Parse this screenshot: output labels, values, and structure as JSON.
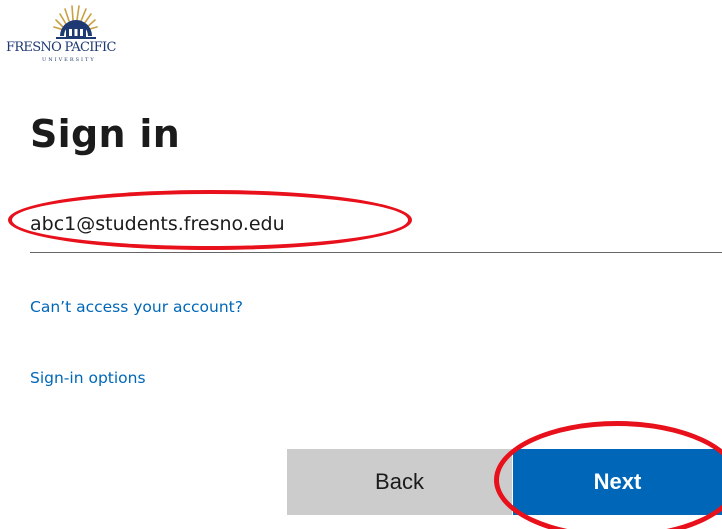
{
  "logo": {
    "wordmark": "FRESNO PACIFIC",
    "subline": "UNIVERSITY",
    "icon": "sunrise-building-crest-icon",
    "colors": {
      "navy": "#1f3a73",
      "gold": "#c9a043"
    }
  },
  "page": {
    "title": "Sign in"
  },
  "email": {
    "value": "abc1@students.fresno.edu"
  },
  "links": {
    "cant_access": "Can’t access your account?",
    "signin_options": "Sign-in options"
  },
  "buttons": {
    "back": "Back",
    "next": "Next"
  },
  "annotations": {
    "highlight_color": "#e8101a"
  },
  "theme": {
    "primary": "#0067b8",
    "secondary_button": "#cccccc",
    "text": "#1b1b1b"
  }
}
